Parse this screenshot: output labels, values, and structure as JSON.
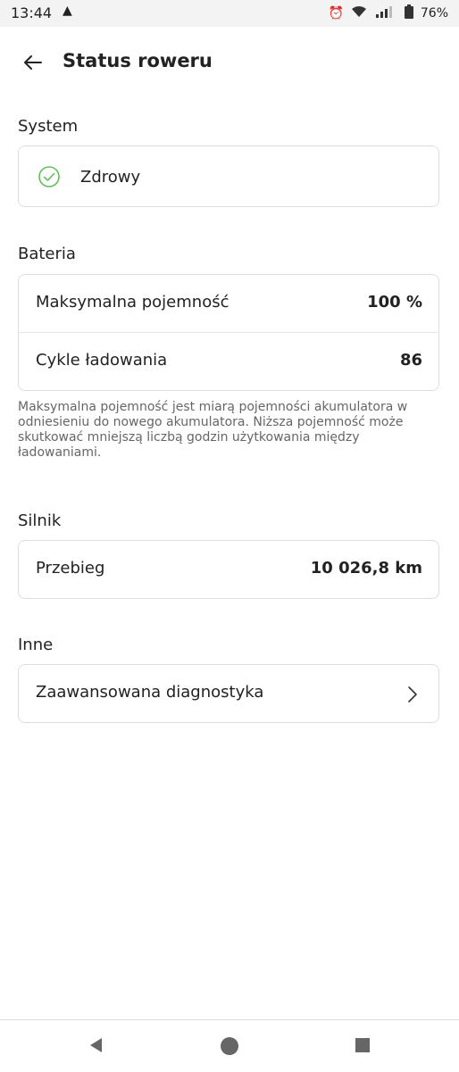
{
  "status_bar": {
    "time": "13:44",
    "battery_percent": "76%"
  },
  "header": {
    "title": "Status roweru"
  },
  "system": {
    "title": "System",
    "status": "Zdrowy",
    "status_color": "#5fbf5a"
  },
  "battery": {
    "title": "Bateria",
    "rows": [
      {
        "label": "Maksymalna pojemność",
        "value": "100 %"
      },
      {
        "label": "Cykle ładowania",
        "value": "86"
      }
    ],
    "note": "Maksymalna pojemność jest miarą pojemności akumulatora w odniesieniu do nowego akumulatora. Niższa pojemność może skutkować mniejszą liczbą godzin użytkowania między ładowaniami."
  },
  "motor": {
    "title": "Silnik",
    "rows": [
      {
        "label": "Przebieg",
        "value": "10 026,8 km"
      }
    ]
  },
  "other": {
    "title": "Inne",
    "items": [
      {
        "label": "Zaawansowana diagnostyka"
      }
    ]
  }
}
